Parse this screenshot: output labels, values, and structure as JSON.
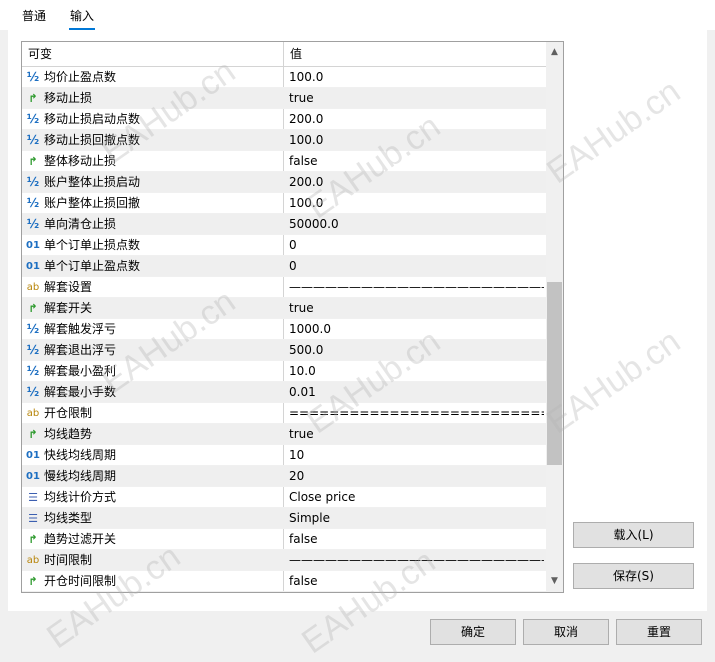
{
  "tabs": [
    {
      "label": "普通",
      "active": false
    },
    {
      "label": "输入",
      "active": true
    }
  ],
  "grid": {
    "header": {
      "name": "可变",
      "value": "值"
    },
    "rows": [
      {
        "icon": "half",
        "name": "均价止盈点数",
        "value": "100.0"
      },
      {
        "icon": "bool",
        "name": "移动止损",
        "value": "true"
      },
      {
        "icon": "half",
        "name": "移动止损启动点数",
        "value": "200.0"
      },
      {
        "icon": "half",
        "name": "移动止损回撤点数",
        "value": "100.0"
      },
      {
        "icon": "bool",
        "name": "整体移动止损",
        "value": "false"
      },
      {
        "icon": "half",
        "name": "账户整体止损启动",
        "value": "200.0"
      },
      {
        "icon": "half",
        "name": "账户整体止损回撤",
        "value": "100.0"
      },
      {
        "icon": "half",
        "name": "单向清仓止损",
        "value": "50000.0"
      },
      {
        "icon": "int",
        "name": "单个订单止损点数",
        "value": "0"
      },
      {
        "icon": "int",
        "name": "单个订单止盈点数",
        "value": "0"
      },
      {
        "icon": "str",
        "name": "解套设置",
        "value": "——————————————————————..."
      },
      {
        "icon": "bool",
        "name": "解套开关",
        "value": "true"
      },
      {
        "icon": "half",
        "name": "解套触发浮亏",
        "value": "1000.0"
      },
      {
        "icon": "half",
        "name": "解套退出浮亏",
        "value": "500.0"
      },
      {
        "icon": "half",
        "name": "解套最小盈利",
        "value": "10.0"
      },
      {
        "icon": "half",
        "name": "解套最小手数",
        "value": "0.01"
      },
      {
        "icon": "str",
        "name": "开仓限制",
        "value": "=========================================..."
      },
      {
        "icon": "bool",
        "name": "均线趋势",
        "value": "true"
      },
      {
        "icon": "int",
        "name": "快线均线周期",
        "value": "10"
      },
      {
        "icon": "int",
        "name": "慢线均线周期",
        "value": "20"
      },
      {
        "icon": "enum",
        "name": "均线计价方式",
        "value": "Close price"
      },
      {
        "icon": "enum",
        "name": "均线类型",
        "value": "Simple"
      },
      {
        "icon": "bool",
        "name": "趋势过滤开关",
        "value": "false"
      },
      {
        "icon": "str",
        "name": "时间限制",
        "value": "——————————————————————..."
      },
      {
        "icon": "bool",
        "name": "开仓时间限制",
        "value": "false"
      }
    ]
  },
  "icons": {
    "half": {
      "glyph": "½",
      "name": "double-type-icon"
    },
    "int": {
      "glyph": "01",
      "name": "integer-type-icon"
    },
    "str": {
      "glyph": "ab",
      "name": "string-type-icon"
    },
    "bool": {
      "glyph": "↱",
      "name": "bool-type-icon"
    },
    "enum": {
      "glyph": "☰",
      "name": "enum-type-icon"
    }
  },
  "buttons": {
    "load": "载入(L)",
    "save": "保存(S)",
    "ok": "确定",
    "cancel": "取消",
    "reset": "重置"
  },
  "watermark_text": "EAHub.cn",
  "colors": {
    "accent": "#0078d7",
    "row_alt": "#efefef"
  }
}
